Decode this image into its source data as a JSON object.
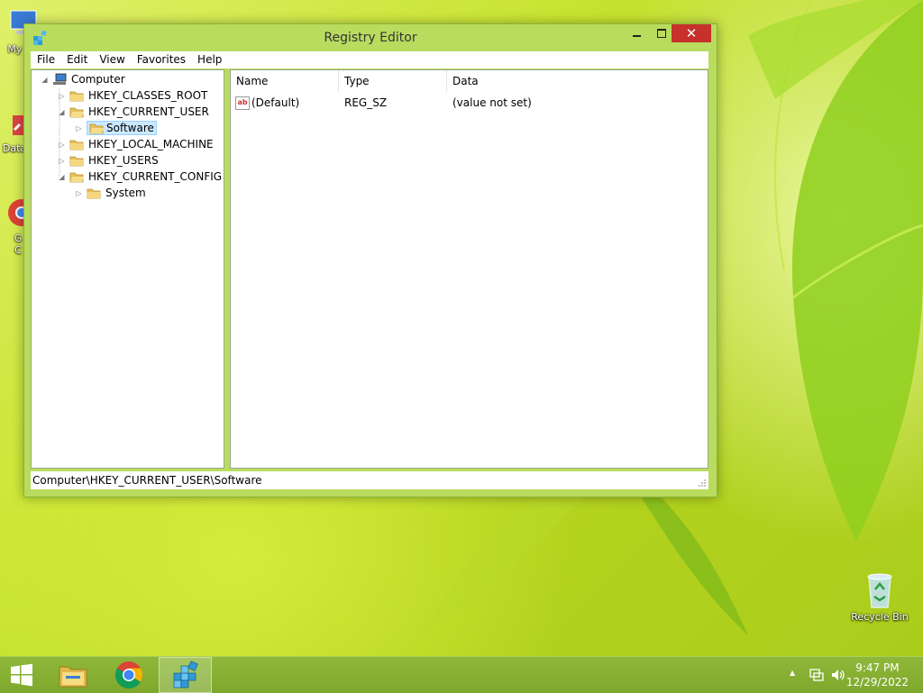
{
  "window": {
    "title": "Registry Editor",
    "close_glyph": "✕"
  },
  "menu": [
    "File",
    "Edit",
    "View",
    "Favorites",
    "Help"
  ],
  "tree": {
    "root": "Computer",
    "items": [
      {
        "label": "HKEY_CLASSES_ROOT",
        "expander": "▷"
      },
      {
        "label": "HKEY_CURRENT_USER",
        "expander": "◢"
      },
      {
        "label": "Software",
        "expander": "▷",
        "selected": true
      },
      {
        "label": "HKEY_LOCAL_MACHINE",
        "expander": "▷"
      },
      {
        "label": "HKEY_USERS",
        "expander": "▷"
      },
      {
        "label": "HKEY_CURRENT_CONFIG",
        "expander": "◢"
      },
      {
        "label": "System",
        "expander": "▷"
      }
    ]
  },
  "list": {
    "columns": [
      "Name",
      "Type",
      "Data"
    ],
    "rows": [
      {
        "icon": "ab",
        "name": "(Default)",
        "type": "REG_SZ",
        "data": "(value not set)"
      }
    ]
  },
  "status": "Computer\\HKEY_CURRENT_USER\\Software",
  "desktop": {
    "recycle_bin": "Recycle Bin",
    "partial_labels": [
      "My C",
      "Data",
      "G",
      "C"
    ]
  },
  "tray": {
    "up_arrow": "▲",
    "time": "9:47 PM",
    "date": "12/29/2022"
  },
  "colors": {
    "accent": "#b9dc5e",
    "close": "#c7302b",
    "selection": "#cce8ff"
  }
}
